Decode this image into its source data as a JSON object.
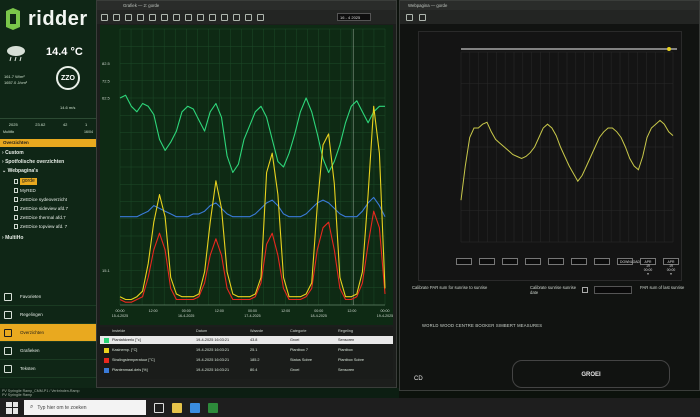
{
  "app": {
    "name": "ridder"
  },
  "weather": {
    "temperature": "14.4 °C",
    "direction": "ZZO",
    "radiation_1": "161.7 W/m²",
    "radiation_2": "1657.0 J/cm²",
    "wind": "14.6 m/s"
  },
  "stats": [
    {
      "label": "2025"
    },
    {
      "label": "23.62"
    },
    {
      "label": "42"
    },
    {
      "label": "1"
    }
  ],
  "datebar": {
    "left": "Multifix",
    "right": "16/04"
  },
  "sidebar": {
    "section_header": "Overzichten",
    "tree": [
      {
        "label": "Custom"
      },
      {
        "label": "Spotfolische overzichten"
      },
      {
        "label": "Webpagina's"
      }
    ],
    "subitems": [
      {
        "label": "gorde"
      },
      {
        "label": "MyRED"
      },
      {
        "label": "ZeEDice sydeoverzicht"
      },
      {
        "label": "ZeEDice sideview afd.7"
      },
      {
        "label": "ZeEDice thermal afd.7"
      },
      {
        "label": "ZeEDice topview afd. 7"
      }
    ],
    "multi": "MultiHo",
    "nav": [
      {
        "label": "Favorieten"
      },
      {
        "label": "Regelingen"
      },
      {
        "label": "Overzichten"
      },
      {
        "label": "Grafieken"
      },
      {
        "label": "Teksten"
      }
    ]
  },
  "chart_window": {
    "title": "Grafiek — 2: gorde",
    "date": "16 - 4 2025"
  },
  "chart_data": {
    "type": "line",
    "x_labels": [
      "00:00\n15-4-2025",
      "12:00",
      "00:00\n16-4-2025",
      "12:00",
      "00:00\n17-4-2025",
      "12:00",
      "00:00\n18-4-2025",
      "12:00",
      "00:00\n19-4-2025"
    ],
    "y_ticks": [
      "",
      "",
      "82.5",
      "72.5",
      "62.5",
      "",
      "",
      "",
      "",
      "",
      "",
      "",
      "",
      "",
      "15.1",
      ""
    ],
    "series": [
      {
        "name": "Plantafdverlo [°c]",
        "color": "#2ed67a",
        "values": [
          75,
          76,
          72,
          70,
          73,
          72,
          69,
          60,
          56,
          59,
          63,
          70,
          72,
          71,
          67,
          63,
          70,
          73,
          68,
          54,
          48,
          51,
          60,
          65,
          70,
          72,
          68,
          60,
          52,
          50,
          55,
          62,
          70,
          75,
          70,
          62,
          53,
          48,
          52,
          58,
          66,
          72,
          74,
          70,
          66,
          70,
          72,
          72
        ]
      },
      {
        "name": "Kasinemp. [°C]",
        "color": "#e8d21e",
        "values": [
          3,
          2,
          2,
          3,
          5,
          15,
          30,
          40,
          32,
          10,
          4,
          3,
          3,
          3,
          4,
          12,
          30,
          45,
          35,
          12,
          4,
          3,
          3,
          3,
          4,
          10,
          48,
          55,
          40,
          10,
          3,
          3,
          3,
          4,
          8,
          36,
          58,
          62,
          44,
          10,
          3,
          3,
          4,
          12,
          40,
          72,
          55,
          6
        ]
      },
      {
        "name": "Stralingstemperatuur [°C]",
        "color": "#e8281e",
        "values": [
          2,
          1,
          1,
          2,
          3,
          10,
          20,
          26,
          20,
          6,
          2,
          2,
          2,
          2,
          3,
          8,
          18,
          24,
          18,
          6,
          2,
          2,
          2,
          2,
          3,
          8,
          22,
          26,
          18,
          6,
          2,
          2,
          2,
          3,
          6,
          20,
          28,
          30,
          20,
          6,
          2,
          2,
          3,
          8,
          22,
          34,
          28,
          4
        ]
      },
      {
        "name": "Plantenmaal.dels [%]",
        "color": "#3a7ad8",
        "values": [
          32,
          32,
          32,
          32,
          33,
          34,
          36,
          35,
          34,
          33,
          32,
          32,
          32,
          33,
          33,
          34,
          36,
          37,
          35,
          33,
          32,
          32,
          32,
          32,
          33,
          35,
          37,
          38,
          36,
          33,
          32,
          32,
          32,
          33,
          35,
          37,
          38,
          37,
          35,
          33,
          32,
          32,
          32,
          34,
          37,
          39,
          36,
          32
        ]
      }
    ],
    "ylim": [
      0,
      100
    ]
  },
  "legend": {
    "headers": [
      "Instelde",
      "Datum",
      "Waarde",
      "Categorie",
      "Regeling"
    ],
    "rows": [
      {
        "name": "Plantafdverlo [°c]",
        "date": "19-4-2025 16:03:21",
        "value": "43.8",
        "category": "Groei",
        "regeling": "Sensoren",
        "color": "#2ed67a"
      },
      {
        "name": "Kasinemp. [°C]",
        "date": "19-4-2025 16:03:21",
        "value": "25.1",
        "category": "Plantbox 7",
        "regeling": "Plantbox",
        "color": "#e8d21e"
      },
      {
        "name": "Stralingstemperatuur [°C]",
        "date": "19-4-2025 16:03:21",
        "value": "185.2",
        "category": "Status Sobre",
        "regeling": "Plantbox Sobre",
        "color": "#e8281e"
      },
      {
        "name": "Plantenmaal.dels [%]",
        "date": "19-4-2025 16:03:21",
        "value": "80.4",
        "category": "Groei",
        "regeling": "Sensoren",
        "color": "#3a7ad8"
      }
    ]
  },
  "web_window": {
    "title": "Webpagina — gorde",
    "buttons": [
      "",
      "",
      "",
      "",
      "",
      "",
      "",
      "DOWNLOAD",
      "APR 19 00:00 ▾",
      "APR 19 00:00 ▾"
    ],
    "cfg_left": "Calibrate PAR sum for sunrise to sunrise",
    "cfg_mid": "Calibrate sunrise sunrise date",
    "cfg_right": "PAR sum of last sunrise",
    "banner": "WORLD WOOD CENTRE BOOKER SIMBERT MEASURES",
    "cta": "GROEI",
    "cd": "CD"
  },
  "web_chart_data": {
    "type": "line",
    "values": [
      22,
      40,
      55,
      60,
      60,
      62,
      63,
      58,
      54,
      52,
      50,
      48,
      46,
      45,
      44,
      45,
      47,
      50,
      55,
      60,
      62,
      60,
      56,
      50,
      45,
      40,
      36,
      32,
      35,
      40,
      45,
      50,
      55,
      58,
      60,
      60,
      58,
      55,
      50,
      44,
      40,
      38,
      45,
      55,
      60,
      62,
      64,
      62,
      58,
      56
    ]
  },
  "status": {
    "line1": "PV Syringile Ramp_CMM-P1 / Verbrinden-Ramp",
    "line2": "PV Syringile Ramp"
  },
  "taskbar": {
    "search": "Typ hier om te zoeken"
  }
}
